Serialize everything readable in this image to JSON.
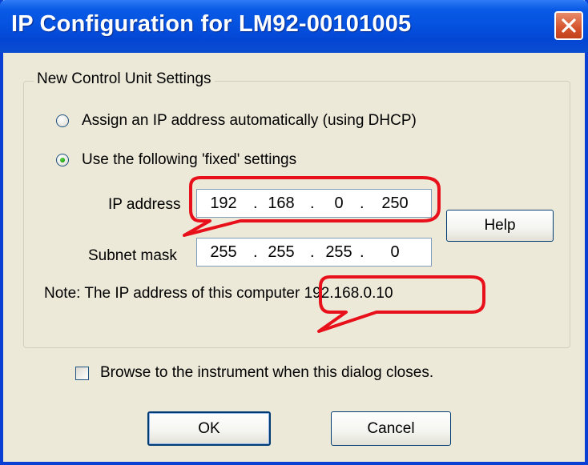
{
  "window": {
    "title": "IP Configuration for LM92-00101005"
  },
  "group": {
    "title": "New Control Unit Settings"
  },
  "options": {
    "dhcp_label": "Assign an IP address automatically (using DHCP)",
    "fixed_label": "Use the following 'fixed' settings",
    "selected": "fixed"
  },
  "fields": {
    "ip_label": "IP address",
    "ip_octets": [
      "192",
      "168",
      "0",
      "250"
    ],
    "mask_label": "Subnet mask",
    "mask_octets": [
      "255",
      "255",
      "255",
      "0"
    ]
  },
  "note": {
    "text": "Note:  The IP address of this computer  192.168.0.10"
  },
  "buttons": {
    "help": "Help",
    "ok": "OK",
    "cancel": "Cancel"
  },
  "browse": {
    "label": "Browse to the instrument when this dialog closes.",
    "checked": false
  },
  "colors": {
    "titlebar": "#0553e0",
    "face": "#ece9d8",
    "callout": "#e8101a",
    "close": "#d4532c"
  }
}
